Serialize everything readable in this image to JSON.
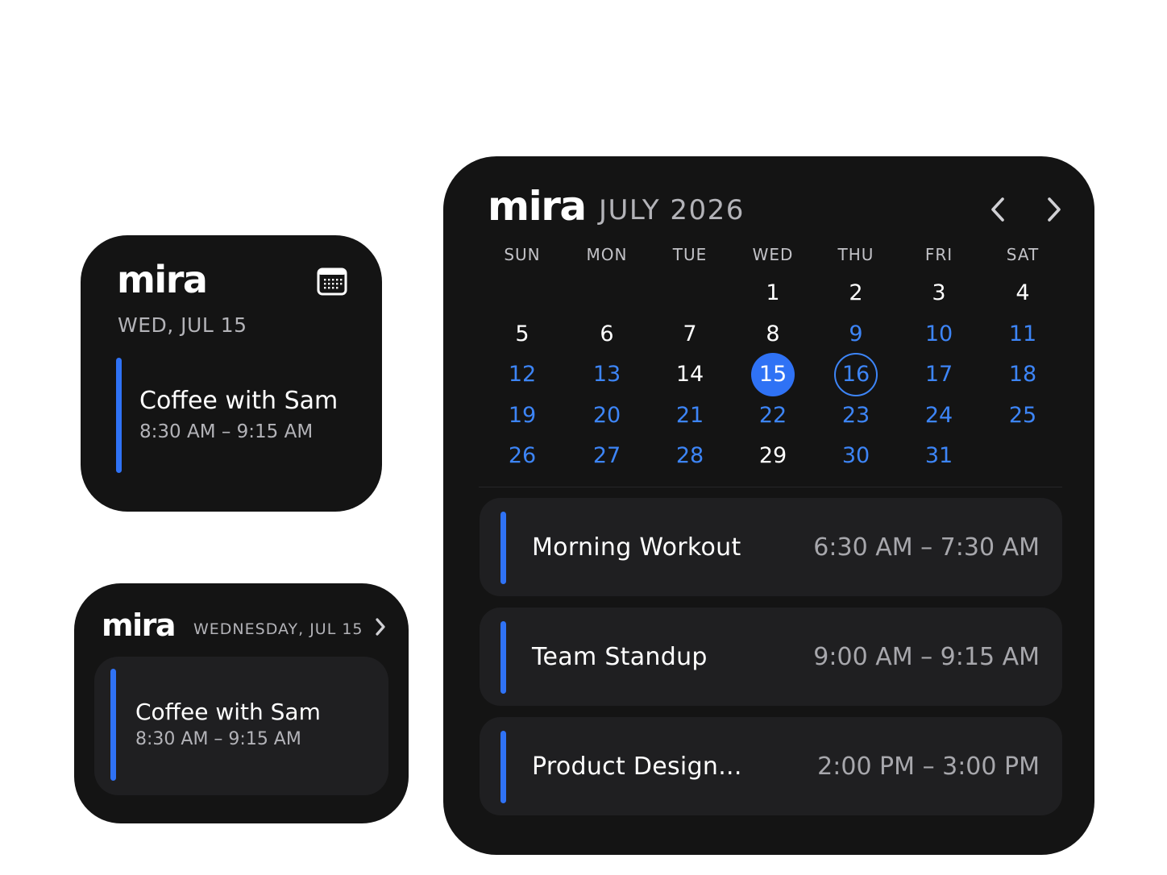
{
  "small_widget": {
    "logo": "mira",
    "date": "WED, JUL 15",
    "event": {
      "title": "Coffee with Sam",
      "time": "8:30 AM – 9:15 AM"
    }
  },
  "medium_widget": {
    "logo": "mira",
    "date": "WEDNESDAY, JUL 15",
    "event": {
      "title": "Coffee with Sam",
      "time": "8:30 AM – 9:15 AM"
    }
  },
  "large_widget": {
    "logo": "mira",
    "month": "JULY 2026",
    "weekdays": [
      "SUN",
      "MON",
      "TUE",
      "WED",
      "THU",
      "FRI",
      "SAT"
    ],
    "days": [
      [
        "",
        "",
        "",
        "1",
        "2",
        "3",
        "4"
      ],
      [
        "5",
        "6",
        "7",
        "8",
        "9",
        "10",
        "11"
      ],
      [
        "12",
        "13",
        "14",
        "15",
        "16",
        "17",
        "18"
      ],
      [
        "19",
        "20",
        "21",
        "22",
        "23",
        "24",
        "25"
      ],
      [
        "26",
        "27",
        "28",
        "29",
        "30",
        "31",
        ""
      ]
    ],
    "today": "15",
    "selected": "16",
    "past_days": [
      "1",
      "2",
      "3",
      "4",
      "5",
      "6",
      "7",
      "8",
      "14",
      "29"
    ],
    "events": [
      {
        "title": "Morning Workout",
        "time": "6:30 AM – 7:30 AM"
      },
      {
        "title": "Team Standup",
        "time": "9:00 AM – 9:15 AM"
      },
      {
        "title": "Product Design...",
        "time": "2:00 PM – 3:00 PM"
      }
    ]
  },
  "icons": {
    "calendar": "calendar-icon",
    "chevron_right": "chevron-right-icon",
    "chevron_left": "chevron-left-icon"
  },
  "colors": {
    "background": "#ffffff",
    "widget": "#141414",
    "card": "#1f1f21",
    "accent": "#2f72f5",
    "muted_text": "#b3b3b8"
  }
}
